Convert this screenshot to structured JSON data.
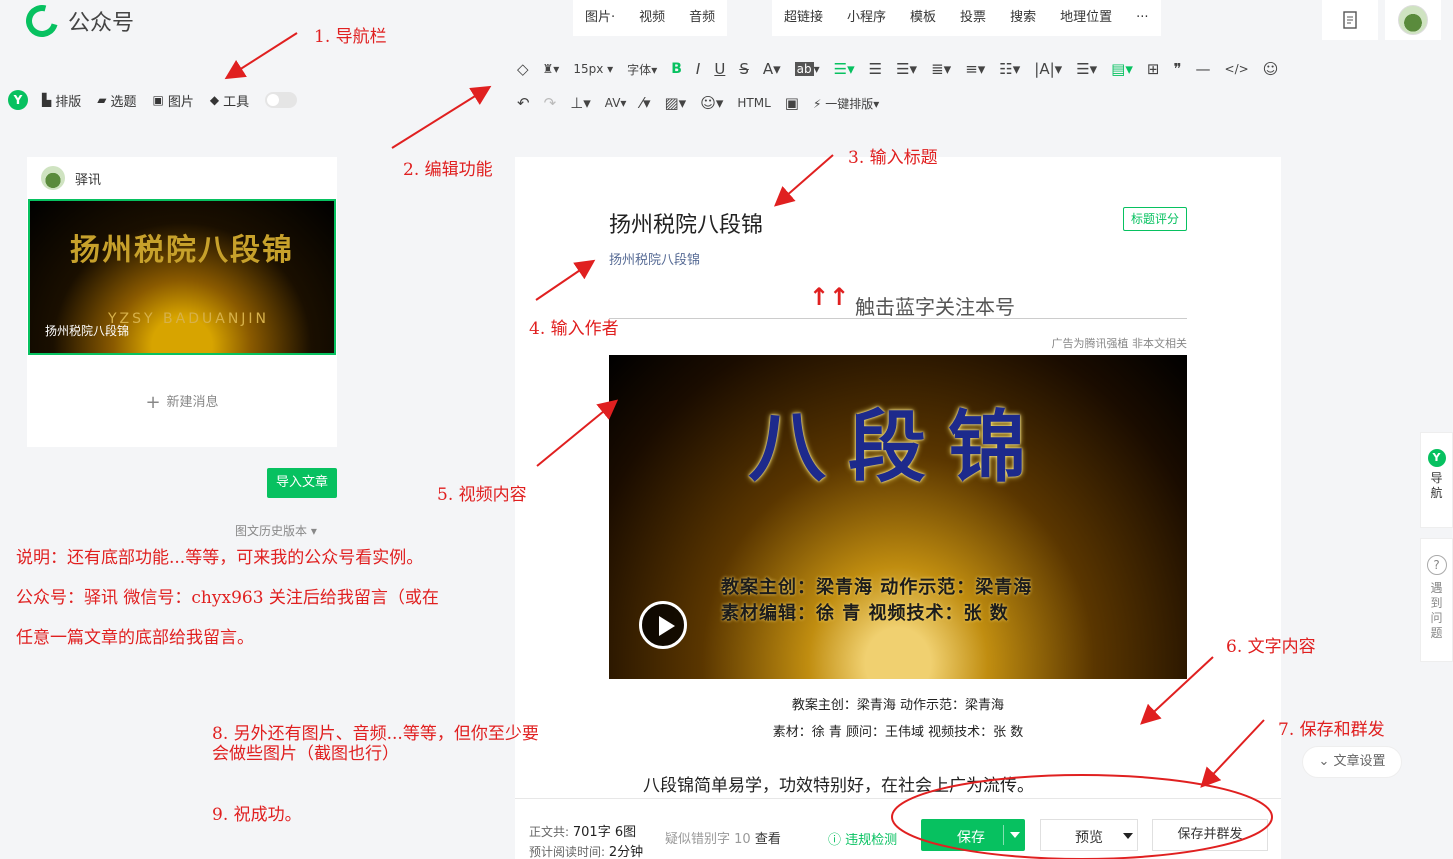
{
  "app": {
    "title": "公众号"
  },
  "top_menu": {
    "group1": [
      "图片·",
      "视频",
      "音频"
    ],
    "group2": [
      "超链接",
      "小程序",
      "模板",
      "投票",
      "搜索",
      "地理位置",
      "···"
    ]
  },
  "toolbar": {
    "font_size": "15px",
    "font_family": "字体",
    "bold": "B",
    "italic": "I",
    "underline": "U",
    "strike": "S",
    "color": "A",
    "bg": "ab",
    "one_click": "一键排版"
  },
  "left_tools": {
    "layout": "排版",
    "topic": "选题",
    "image": "图片",
    "tools": "工具"
  },
  "card": {
    "account": "驿讯",
    "cover_title": "扬州税院八段锦",
    "cover_sub": "YZSY   BADUANJIN",
    "cover_caption": "扬州税院八段锦",
    "new_message": "新建消息"
  },
  "import_button": "导入文章",
  "history": "图文历史版本",
  "editor": {
    "title": "扬州税院八段锦",
    "title_score": "标题评分",
    "author": "扬州税院八段锦",
    "follow_arrows": "↑↑",
    "follow_text": "触击蓝字关注本号",
    "ad_note": "广告为腾讯强植 非本文相关",
    "video_title": "八段锦",
    "video_credit_1": "教案主创：梁青海   动作示范：梁青海",
    "video_credit_2": "素材编辑：徐  青   视频技术：张  数",
    "line1": "教案主创：梁青海    动作示范：梁青海",
    "line2": "素材：徐    青    顾问：王伟域    视频技术：张    数",
    "paragraph": "八段锦简单易学，功效特别好，在社会上广为流传。"
  },
  "bottom": {
    "word_label": "正文共:",
    "word_value": "701字 6图",
    "read_label": "预计阅读时间:",
    "read_value": "2分钟",
    "typo_label": "疑似错别字",
    "typo_count": "10",
    "typo_view": "查看",
    "violation": "违规检测",
    "save": "保存",
    "preview": "预览",
    "publish": "保存并群发"
  },
  "article_settings": "文章设置",
  "side_nav": {
    "label": "导航"
  },
  "side_help": {
    "label": "遇到问题"
  },
  "annotations": {
    "a1": "1. 导航栏",
    "a2": "2. 编辑功能",
    "a3": "3. 输入标题",
    "a4": "4. 输入作者",
    "a5": "5. 视频内容",
    "a6": "6. 文字内容",
    "a7": "7. 保存和群发",
    "a8_1": "8. 另外还有图片、音频...等等，但你至少要",
    "a8_2": "会做些图片（截图也行）",
    "a9": "9. 祝成功。",
    "note1": "说明：还有底部功能...等等，可来我的公众号看实例。",
    "note2": "公众号：驿讯   微信号：chyx963 关注后给我留言（或在",
    "note3": "任意一篇文章的底部给我留言。"
  },
  "colors": {
    "accent": "#07c160",
    "annotation": "#e02020",
    "author": "#576b95"
  }
}
